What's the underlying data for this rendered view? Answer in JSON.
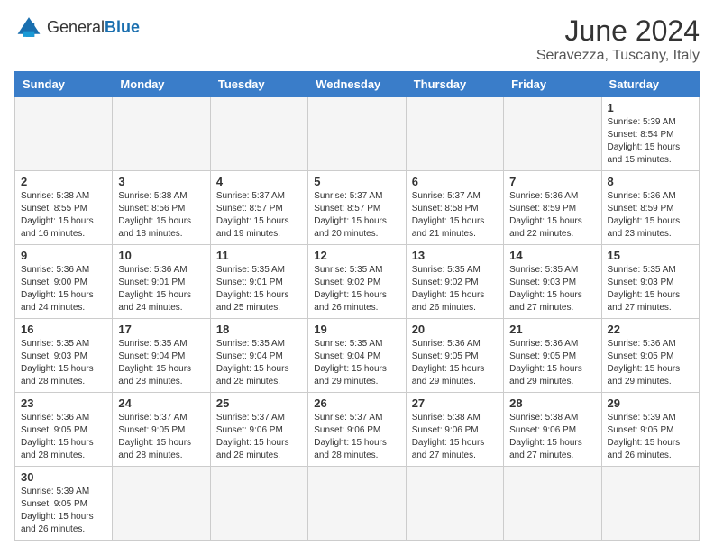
{
  "logo": {
    "text_general": "General",
    "text_blue": "Blue"
  },
  "title": "June 2024",
  "location": "Seravezza, Tuscany, Italy",
  "weekdays": [
    "Sunday",
    "Monday",
    "Tuesday",
    "Wednesday",
    "Thursday",
    "Friday",
    "Saturday"
  ],
  "days": {
    "1": {
      "sunrise": "5:39 AM",
      "sunset": "8:54 PM",
      "daylight": "15 hours and 15 minutes."
    },
    "2": {
      "sunrise": "5:38 AM",
      "sunset": "8:55 PM",
      "daylight": "15 hours and 16 minutes."
    },
    "3": {
      "sunrise": "5:38 AM",
      "sunset": "8:56 PM",
      "daylight": "15 hours and 18 minutes."
    },
    "4": {
      "sunrise": "5:37 AM",
      "sunset": "8:57 PM",
      "daylight": "15 hours and 19 minutes."
    },
    "5": {
      "sunrise": "5:37 AM",
      "sunset": "8:57 PM",
      "daylight": "15 hours and 20 minutes."
    },
    "6": {
      "sunrise": "5:37 AM",
      "sunset": "8:58 PM",
      "daylight": "15 hours and 21 minutes."
    },
    "7": {
      "sunrise": "5:36 AM",
      "sunset": "8:59 PM",
      "daylight": "15 hours and 22 minutes."
    },
    "8": {
      "sunrise": "5:36 AM",
      "sunset": "8:59 PM",
      "daylight": "15 hours and 23 minutes."
    },
    "9": {
      "sunrise": "5:36 AM",
      "sunset": "9:00 PM",
      "daylight": "15 hours and 24 minutes."
    },
    "10": {
      "sunrise": "5:36 AM",
      "sunset": "9:01 PM",
      "daylight": "15 hours and 24 minutes."
    },
    "11": {
      "sunrise": "5:35 AM",
      "sunset": "9:01 PM",
      "daylight": "15 hours and 25 minutes."
    },
    "12": {
      "sunrise": "5:35 AM",
      "sunset": "9:02 PM",
      "daylight": "15 hours and 26 minutes."
    },
    "13": {
      "sunrise": "5:35 AM",
      "sunset": "9:02 PM",
      "daylight": "15 hours and 26 minutes."
    },
    "14": {
      "sunrise": "5:35 AM",
      "sunset": "9:03 PM",
      "daylight": "15 hours and 27 minutes."
    },
    "15": {
      "sunrise": "5:35 AM",
      "sunset": "9:03 PM",
      "daylight": "15 hours and 27 minutes."
    },
    "16": {
      "sunrise": "5:35 AM",
      "sunset": "9:03 PM",
      "daylight": "15 hours and 28 minutes."
    },
    "17": {
      "sunrise": "5:35 AM",
      "sunset": "9:04 PM",
      "daylight": "15 hours and 28 minutes."
    },
    "18": {
      "sunrise": "5:35 AM",
      "sunset": "9:04 PM",
      "daylight": "15 hours and 28 minutes."
    },
    "19": {
      "sunrise": "5:35 AM",
      "sunset": "9:04 PM",
      "daylight": "15 hours and 29 minutes."
    },
    "20": {
      "sunrise": "5:36 AM",
      "sunset": "9:05 PM",
      "daylight": "15 hours and 29 minutes."
    },
    "21": {
      "sunrise": "5:36 AM",
      "sunset": "9:05 PM",
      "daylight": "15 hours and 29 minutes."
    },
    "22": {
      "sunrise": "5:36 AM",
      "sunset": "9:05 PM",
      "daylight": "15 hours and 29 minutes."
    },
    "23": {
      "sunrise": "5:36 AM",
      "sunset": "9:05 PM",
      "daylight": "15 hours and 28 minutes."
    },
    "24": {
      "sunrise": "5:37 AM",
      "sunset": "9:05 PM",
      "daylight": "15 hours and 28 minutes."
    },
    "25": {
      "sunrise": "5:37 AM",
      "sunset": "9:06 PM",
      "daylight": "15 hours and 28 minutes."
    },
    "26": {
      "sunrise": "5:37 AM",
      "sunset": "9:06 PM",
      "daylight": "15 hours and 28 minutes."
    },
    "27": {
      "sunrise": "5:38 AM",
      "sunset": "9:06 PM",
      "daylight": "15 hours and 27 minutes."
    },
    "28": {
      "sunrise": "5:38 AM",
      "sunset": "9:06 PM",
      "daylight": "15 hours and 27 minutes."
    },
    "29": {
      "sunrise": "5:39 AM",
      "sunset": "9:05 PM",
      "daylight": "15 hours and 26 minutes."
    },
    "30": {
      "sunrise": "5:39 AM",
      "sunset": "9:05 PM",
      "daylight": "15 hours and 26 minutes."
    }
  }
}
